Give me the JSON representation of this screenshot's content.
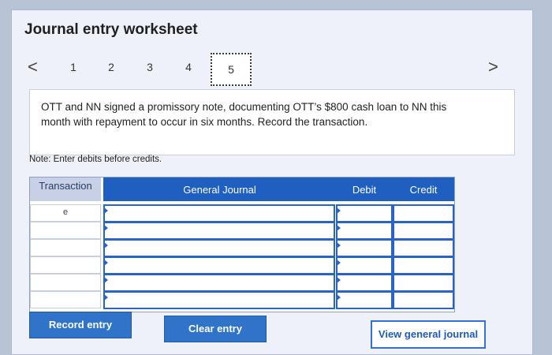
{
  "header": {
    "title": "Journal entry worksheet"
  },
  "pager": {
    "prev_icon": "chevron-left-icon",
    "next_icon": "chevron-right-icon",
    "prev_glyph": "<",
    "next_glyph": ">",
    "pages": [
      "1",
      "2",
      "3",
      "4",
      "5"
    ],
    "active_page": "5"
  },
  "question": {
    "text": "OTT and NN signed a promissory note, documenting OTT’s $800 cash loan to NN this month with repayment to occur in six months. Record the transaction."
  },
  "note": {
    "text": "Note: Enter debits before credits."
  },
  "journal": {
    "columns": {
      "transaction": "Transaction",
      "general_journal": "General Journal",
      "debit": "Debit",
      "credit": "Credit"
    },
    "rows": [
      {
        "transaction": "e",
        "account": "",
        "debit": "",
        "credit": ""
      },
      {
        "transaction": "",
        "account": "",
        "debit": "",
        "credit": ""
      },
      {
        "transaction": "",
        "account": "",
        "debit": "",
        "credit": ""
      },
      {
        "transaction": "",
        "account": "",
        "debit": "",
        "credit": ""
      },
      {
        "transaction": "",
        "account": "",
        "debit": "",
        "credit": ""
      },
      {
        "transaction": "",
        "account": "",
        "debit": "",
        "credit": ""
      }
    ]
  },
  "buttons": {
    "record": "Record entry",
    "clear": "Clear entry",
    "view": "View general journal"
  },
  "colors": {
    "header_blue": "#1f5fbf",
    "button_blue": "#2f74c9",
    "outline_blue": "#2b63c2"
  }
}
